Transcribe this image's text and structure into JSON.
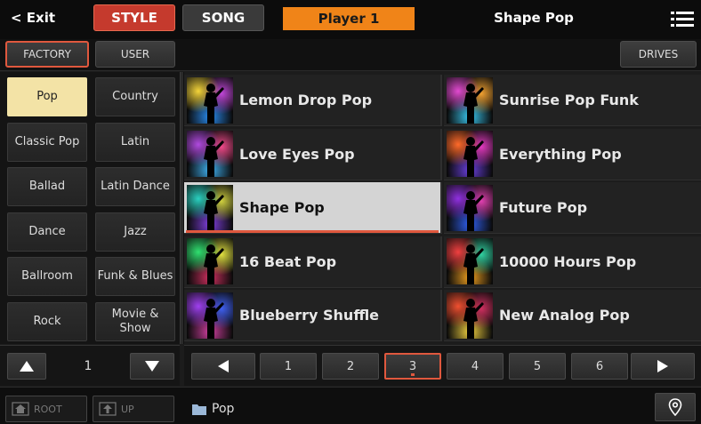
{
  "topbar": {
    "exit_label": "< Exit",
    "mode_style": "STYLE",
    "mode_song": "SONG",
    "player": "Player 1",
    "current_style": "Shape Pop",
    "menu_icon": "menu-list-icon"
  },
  "subbar": {
    "factory": "FACTORY",
    "user": "USER",
    "drives": "DRIVES"
  },
  "categories": [
    {
      "label": "Pop",
      "selected": true
    },
    {
      "label": "Country"
    },
    {
      "label": "Classic Pop"
    },
    {
      "label": "Latin"
    },
    {
      "label": "Ballad"
    },
    {
      "label": "Latin Dance"
    },
    {
      "label": "Dance"
    },
    {
      "label": "Jazz"
    },
    {
      "label": "Ballroom"
    },
    {
      "label": "Funk & Blues"
    },
    {
      "label": "Rock"
    },
    {
      "label": "Movie & Show"
    }
  ],
  "styles": [
    {
      "label": "Lemon Drop Pop",
      "colors": [
        "#f4d43a",
        "#c046d8",
        "#2a8cf0"
      ]
    },
    {
      "label": "Sunrise Pop Funk",
      "colors": [
        "#e24ad0",
        "#f0a030",
        "#3ac8f0"
      ]
    },
    {
      "label": "Love Eyes Pop",
      "colors": [
        "#b04adf",
        "#f04a8a",
        "#40b0f0"
      ]
    },
    {
      "label": "Everything Pop",
      "colors": [
        "#ff6a2a",
        "#e23ac0",
        "#6a40e0"
      ]
    },
    {
      "label": "Shape Pop",
      "colors": [
        "#2ad0c0",
        "#d0d040",
        "#8040e0"
      ],
      "selected": true
    },
    {
      "label": "Future Pop",
      "colors": [
        "#9030e0",
        "#e040b0",
        "#3060f0"
      ]
    },
    {
      "label": "16 Beat Pop",
      "colors": [
        "#30e070",
        "#e0e040",
        "#d03060"
      ]
    },
    {
      "label": "10000 Hours Pop",
      "colors": [
        "#f04040",
        "#30d0a0",
        "#f0a020"
      ]
    },
    {
      "label": "Blueberry Shuffle",
      "colors": [
        "#a040f0",
        "#4060f0",
        "#d040a0"
      ]
    },
    {
      "label": "New Analog Pop",
      "colors": [
        "#f05030",
        "#d03060",
        "#f0d040"
      ]
    }
  ],
  "category_pager": {
    "page": "1",
    "up_icon": "triangle-up-icon",
    "down_icon": "triangle-down-icon"
  },
  "style_pager": {
    "prev_icon": "triangle-left-icon",
    "next_icon": "triangle-right-icon",
    "pages": [
      "1",
      "2",
      "3",
      "4",
      "5",
      "6"
    ],
    "current": "3"
  },
  "footer": {
    "root": "ROOT",
    "up": "UP",
    "path": "Pop",
    "location_icon": "location-pin-icon"
  }
}
